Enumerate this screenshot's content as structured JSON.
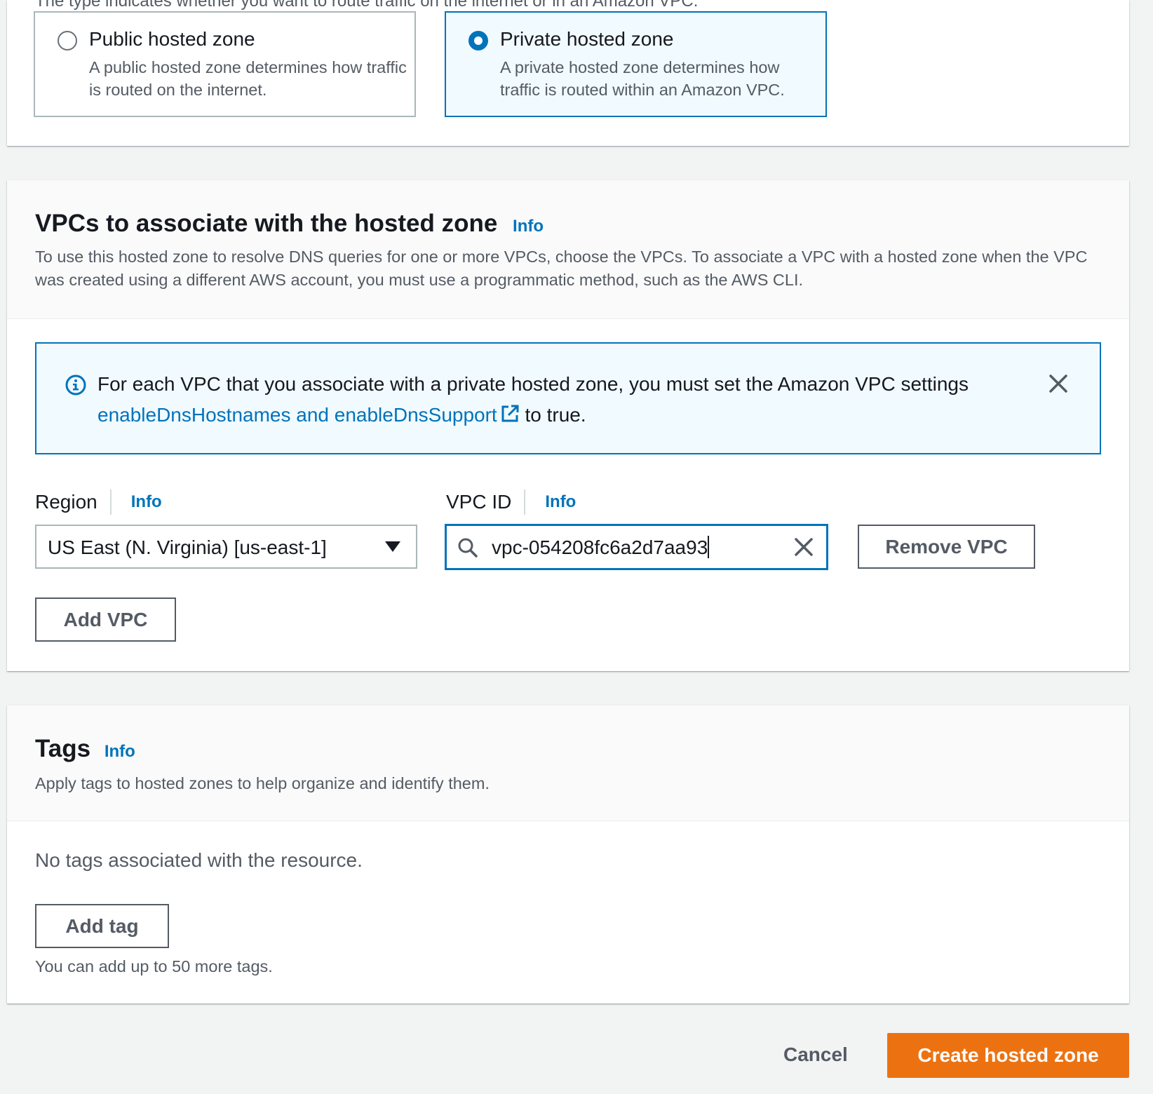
{
  "hosted_zone_type": {
    "cut_text": "The type indicates whether you want to route traffic on the internet or in an Amazon VPC.",
    "options": [
      {
        "title": "Public hosted zone",
        "description": "A public hosted zone determines how traffic is routed on the internet.",
        "selected": false
      },
      {
        "title": "Private hosted zone",
        "description": "A private hosted zone determines how traffic is routed within an Amazon VPC.",
        "selected": true
      }
    ]
  },
  "vpc_section": {
    "title": "VPCs to associate with the hosted zone",
    "info": "Info",
    "description": "To use this hosted zone to resolve DNS queries for one or more VPCs, choose the VPCs. To associate a VPC with a hosted zone when the VPC was created using a different AWS account, you must use a programmatic method, such as the AWS CLI.",
    "alert": {
      "text_before": "For each VPC that you associate with a private hosted zone, you must set the Amazon VPC settings",
      "link_text": "enableDnsHostnames and enableDnsSupport",
      "text_after": "to true."
    },
    "region_label": "Region",
    "region_info": "Info",
    "region_value": "US East (N. Virginia) [us-east-1]",
    "vpc_id_label": "VPC ID",
    "vpc_id_info": "Info",
    "vpc_id_value": "vpc-054208fc6a2d7aa93",
    "remove_vpc": "Remove VPC",
    "add_vpc": "Add VPC"
  },
  "tags_section": {
    "title": "Tags",
    "info": "Info",
    "description": "Apply tags to hosted zones to help organize and identify them.",
    "empty": "No tags associated with the resource.",
    "add_tag": "Add tag",
    "hint": "You can add up to 50 more tags."
  },
  "footer": {
    "cancel": "Cancel",
    "create": "Create hosted zone"
  },
  "colors": {
    "accent": "#0073bb",
    "primary_button": "#ec7211",
    "background": "#f2f3f3"
  }
}
